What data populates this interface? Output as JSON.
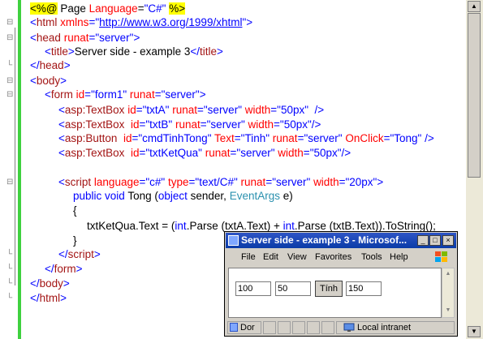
{
  "editor": {
    "lines": [
      {
        "segs": [
          [
            "hl",
            "<%@"
          ],
          [
            "txt",
            " Page "
          ],
          [
            "attr",
            "Language"
          ],
          [
            "txt",
            "="
          ],
          [
            "str",
            "\"C#\""
          ],
          [
            "txt",
            " "
          ],
          [
            "hl",
            "%>"
          ]
        ]
      },
      {
        "segs": [
          [
            "kw",
            "<"
          ],
          [
            "tag",
            "html"
          ],
          [
            "txt",
            " "
          ],
          [
            "attr",
            "xmlns"
          ],
          [
            "kw",
            "="
          ],
          [
            "str",
            "\""
          ],
          [
            "link",
            "http://www.w3.org/1999/xhtml"
          ],
          [
            "str",
            "\""
          ],
          [
            "kw",
            ">"
          ]
        ]
      },
      {
        "segs": [
          [
            "kw",
            "<"
          ],
          [
            "tag",
            "head"
          ],
          [
            "txt",
            " "
          ],
          [
            "attr",
            "runat"
          ],
          [
            "kw",
            "="
          ],
          [
            "str",
            "\"server\""
          ],
          [
            "kw",
            ">"
          ]
        ]
      },
      {
        "segs": [
          [
            "kw",
            "<"
          ],
          [
            "tag",
            "title"
          ],
          [
            "kw",
            ">"
          ],
          [
            "txt",
            "Server side - example 3"
          ],
          [
            "kw",
            "</"
          ],
          [
            "tag",
            "title"
          ],
          [
            "kw",
            ">"
          ]
        ]
      },
      {
        "segs": [
          [
            "kw",
            "</"
          ],
          [
            "tag",
            "head"
          ],
          [
            "kw",
            ">"
          ]
        ]
      },
      {
        "segs": [
          [
            "kw",
            "<"
          ],
          [
            "tag",
            "body"
          ],
          [
            "kw",
            ">"
          ]
        ]
      },
      {
        "segs": [
          [
            "kw",
            "<"
          ],
          [
            "tag",
            "form"
          ],
          [
            "txt",
            " "
          ],
          [
            "attr",
            "id"
          ],
          [
            "kw",
            "="
          ],
          [
            "str",
            "\"form1\""
          ],
          [
            "txt",
            " "
          ],
          [
            "attr",
            "runat"
          ],
          [
            "kw",
            "="
          ],
          [
            "str",
            "\"server\""
          ],
          [
            "kw",
            ">"
          ]
        ]
      },
      {
        "segs": [
          [
            "kw",
            "<"
          ],
          [
            "tag",
            "asp:TextBox"
          ],
          [
            "txt",
            " "
          ],
          [
            "attr",
            "id"
          ],
          [
            "kw",
            "="
          ],
          [
            "str",
            "\"txtA\""
          ],
          [
            "txt",
            " "
          ],
          [
            "attr",
            "runat"
          ],
          [
            "kw",
            "="
          ],
          [
            "str",
            "\"server\""
          ],
          [
            "txt",
            " "
          ],
          [
            "attr",
            "width"
          ],
          [
            "kw",
            "="
          ],
          [
            "str",
            "\"50px\""
          ],
          [
            "txt",
            "  "
          ],
          [
            "kw",
            "/>"
          ]
        ]
      },
      {
        "segs": [
          [
            "kw",
            "<"
          ],
          [
            "tag",
            "asp:TextBox"
          ],
          [
            "txt",
            "  "
          ],
          [
            "attr",
            "id"
          ],
          [
            "kw",
            "="
          ],
          [
            "str",
            "\"txtB\""
          ],
          [
            "txt",
            " "
          ],
          [
            "attr",
            "runat"
          ],
          [
            "kw",
            "="
          ],
          [
            "str",
            "\"server\""
          ],
          [
            "txt",
            " "
          ],
          [
            "attr",
            "width"
          ],
          [
            "kw",
            "="
          ],
          [
            "str",
            "\"50px\""
          ],
          [
            "kw",
            "/>"
          ]
        ]
      },
      {
        "segs": [
          [
            "kw",
            "<"
          ],
          [
            "tag",
            "asp:Button"
          ],
          [
            "txt",
            "  "
          ],
          [
            "attr",
            "id"
          ],
          [
            "kw",
            "="
          ],
          [
            "str",
            "\"cmdTinhTong\""
          ],
          [
            "txt",
            " "
          ],
          [
            "attr",
            "Text"
          ],
          [
            "kw",
            "="
          ],
          [
            "str",
            "\"Tinh\""
          ],
          [
            "txt",
            " "
          ],
          [
            "attr",
            "runat"
          ],
          [
            "kw",
            "="
          ],
          [
            "str",
            "\"server\""
          ],
          [
            "txt",
            " "
          ],
          [
            "attr",
            "OnClick"
          ],
          [
            "kw",
            "="
          ],
          [
            "str",
            "\"Tong\""
          ],
          [
            "txt",
            " "
          ],
          [
            "kw",
            "/>"
          ]
        ]
      },
      {
        "segs": [
          [
            "kw",
            "<"
          ],
          [
            "tag",
            "asp:TextBox"
          ],
          [
            "txt",
            "  "
          ],
          [
            "attr",
            "id"
          ],
          [
            "kw",
            "="
          ],
          [
            "str",
            "\"txtKetQua\""
          ],
          [
            "txt",
            " "
          ],
          [
            "attr",
            "runat"
          ],
          [
            "kw",
            "="
          ],
          [
            "str",
            "\"server\""
          ],
          [
            "txt",
            " "
          ],
          [
            "attr",
            "width"
          ],
          [
            "kw",
            "="
          ],
          [
            "str",
            "\"50px\""
          ],
          [
            "kw",
            "/>"
          ]
        ]
      },
      {
        "segs": []
      },
      {
        "segs": [
          [
            "kw",
            "<"
          ],
          [
            "tag",
            "script"
          ],
          [
            "txt",
            " "
          ],
          [
            "attr",
            "language"
          ],
          [
            "kw",
            "="
          ],
          [
            "str",
            "\"c#\""
          ],
          [
            "txt",
            " "
          ],
          [
            "attr",
            "type"
          ],
          [
            "kw",
            "="
          ],
          [
            "str",
            "\"text/C#\""
          ],
          [
            "txt",
            " "
          ],
          [
            "attr",
            "runat"
          ],
          [
            "kw",
            "="
          ],
          [
            "str",
            "\"server\""
          ],
          [
            "txt",
            " "
          ],
          [
            "attr",
            "width"
          ],
          [
            "kw",
            "="
          ],
          [
            "str",
            "\"20px\""
          ],
          [
            "kw",
            ">"
          ]
        ]
      },
      {
        "segs": [
          [
            "kw",
            "public"
          ],
          [
            "txt",
            " "
          ],
          [
            "kw",
            "void"
          ],
          [
            "txt",
            " Tong "
          ],
          [
            "txt",
            "("
          ],
          [
            "kw",
            "object"
          ],
          [
            "txt",
            " sender, "
          ],
          [
            "typ",
            "EventArgs"
          ],
          [
            "txt",
            " e)"
          ]
        ]
      },
      {
        "segs": [
          [
            "txt",
            "{"
          ]
        ]
      },
      {
        "segs": [
          [
            "txt",
            "txtKetQua.Text = ("
          ],
          [
            "kw",
            "int"
          ],
          [
            "txt",
            ".Parse (txtA.Text) + "
          ],
          [
            "kw",
            "int"
          ],
          [
            "txt",
            ".Parse (txtB.Text)).ToString();"
          ]
        ]
      },
      {
        "segs": [
          [
            "txt",
            "}"
          ]
        ]
      },
      {
        "segs": [
          [
            "kw",
            "</"
          ],
          [
            "tag",
            "script"
          ],
          [
            "kw",
            ">"
          ]
        ]
      },
      {
        "segs": [
          [
            "kw",
            "</"
          ],
          [
            "tag",
            "form"
          ],
          [
            "kw",
            ">"
          ]
        ]
      },
      {
        "segs": [
          [
            "kw",
            "</"
          ],
          [
            "tag",
            "body"
          ],
          [
            "kw",
            ">"
          ]
        ]
      },
      {
        "segs": [
          [
            "kw",
            "</"
          ],
          [
            "tag",
            "html"
          ],
          [
            "kw",
            ">"
          ]
        ]
      }
    ]
  },
  "browser": {
    "title": "Server side - example 3 - Microsof...",
    "min_glyph": "_",
    "max_glyph": "□",
    "close_glyph": "×",
    "menu": [
      "File",
      "Edit",
      "View",
      "Favorites",
      "Tools",
      "Help"
    ],
    "txtA": "100",
    "txtB": "50",
    "button": "Tính",
    "result": "150",
    "status_left": "Dor",
    "status_right": "Local intranet"
  },
  "colors": {
    "accent": "#0a3ba7",
    "gutter": "#3fd13f"
  }
}
